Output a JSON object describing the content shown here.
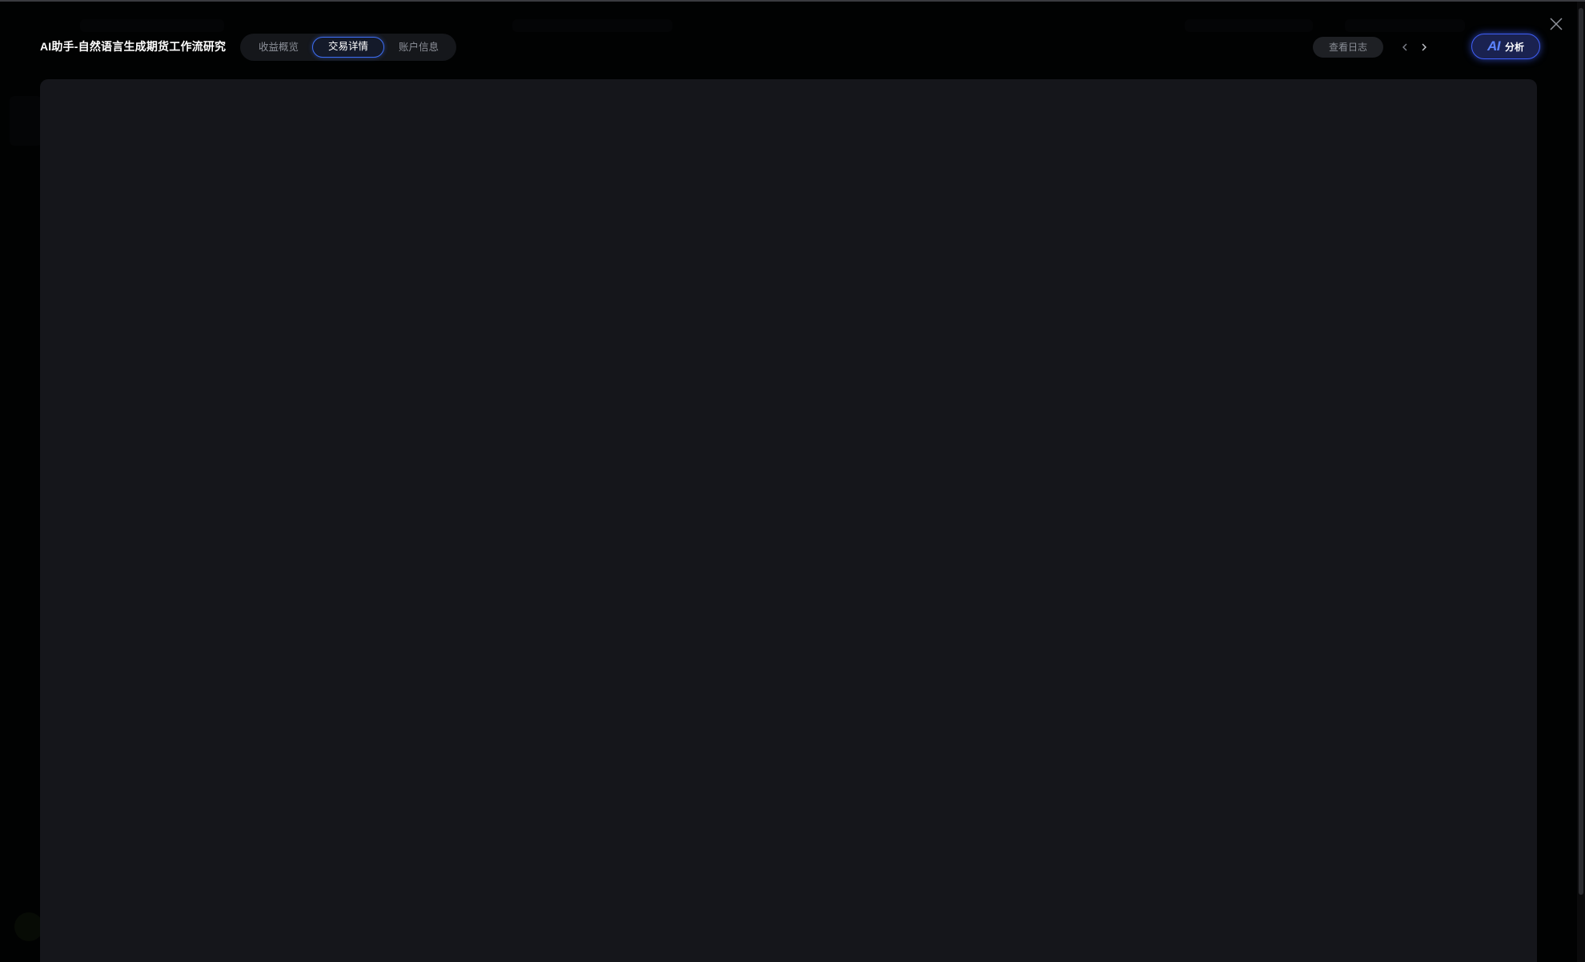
{
  "modal": {
    "title": "AI助手-自然语言生成期货工作流研究"
  },
  "tabs": [
    {
      "label": "收益概览",
      "active": false
    },
    {
      "label": "交易详情",
      "active": true
    },
    {
      "label": "账户信息",
      "active": false
    }
  ],
  "toolbar": {
    "log_label": "查看日志",
    "prev_icon": "chevron-left-icon",
    "next_icon": "chevron-right-icon",
    "ai_logo": "AI",
    "ai_label": "分析",
    "close_icon": "close-icon"
  },
  "colors": {
    "accent": "#3d6df2",
    "panel": "#15161b",
    "background": "#000000"
  }
}
